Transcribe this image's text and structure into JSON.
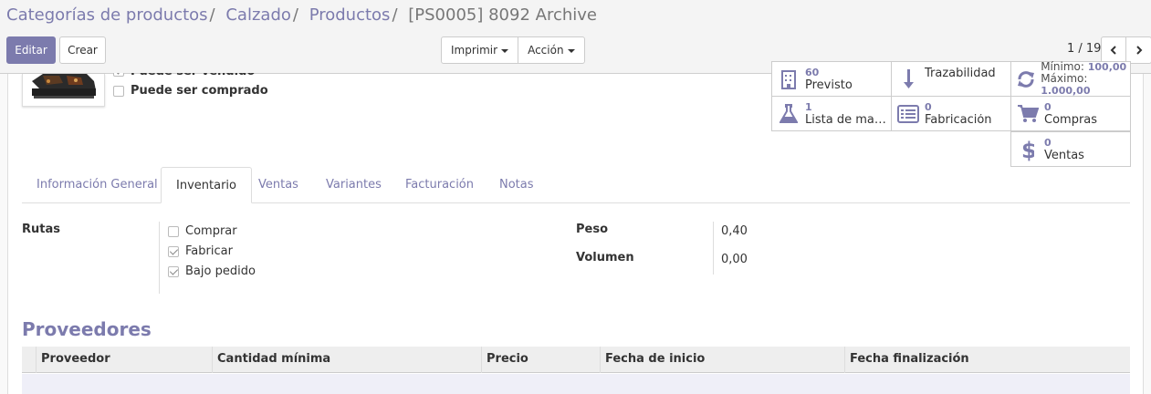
{
  "breadcrumb": [
    "Categorías de productos",
    "Calzado",
    "Productos",
    "[PS0005] 8092 Archive"
  ],
  "buttons": {
    "edit": "Editar",
    "create": "Crear",
    "print": "Imprimir",
    "action": "Acción"
  },
  "pager": {
    "value": "1 / 19"
  },
  "checkboxes": {
    "can_be_sold": {
      "label": "Puede ser vendido",
      "checked": true
    },
    "can_be_purchased": {
      "label": "Puede ser comprado",
      "checked": false
    }
  },
  "smart_buttons": {
    "forecast": {
      "value": "60",
      "label": "Previsto",
      "icon": "building-icon"
    },
    "traceability": {
      "label": "Trazabilidad",
      "icon": "arrow-down-icon"
    },
    "reorder": {
      "min_label": "Mínimo:",
      "min_value": "100,00",
      "max_label": "Máximo:",
      "max_value": "1.000,00",
      "icon": "refresh-icon"
    },
    "bom": {
      "value": "1",
      "label": "Lista de mat…",
      "icon": "flask-icon"
    },
    "manufacturing": {
      "value": "0",
      "label": "Fabricación",
      "icon": "list-icon"
    },
    "purchases": {
      "value": "0",
      "label": "Compras",
      "icon": "cart-icon"
    },
    "sales": {
      "value": "0",
      "label": "Ventas",
      "icon": "dollar-icon"
    }
  },
  "tabs": [
    "Información General",
    "Inventario",
    "Ventas",
    "Variantes",
    "Facturación",
    "Notas"
  ],
  "active_tab": "Inventario",
  "inventory": {
    "routes_label": "Rutas",
    "routes": [
      {
        "label": "Comprar",
        "checked": false
      },
      {
        "label": "Fabricar",
        "checked": true
      },
      {
        "label": "Bajo pedido",
        "checked": true
      }
    ],
    "weight_label": "Peso",
    "weight_value": "0,40",
    "volume_label": "Volumen",
    "volume_value": "0,00"
  },
  "vendors": {
    "title": "Proveedores",
    "columns": [
      "Proveedor",
      "Cantidad mínima",
      "Precio",
      "Fecha de inicio",
      "Fecha finalización"
    ]
  },
  "colors": {
    "accent": "#7c7bad"
  }
}
